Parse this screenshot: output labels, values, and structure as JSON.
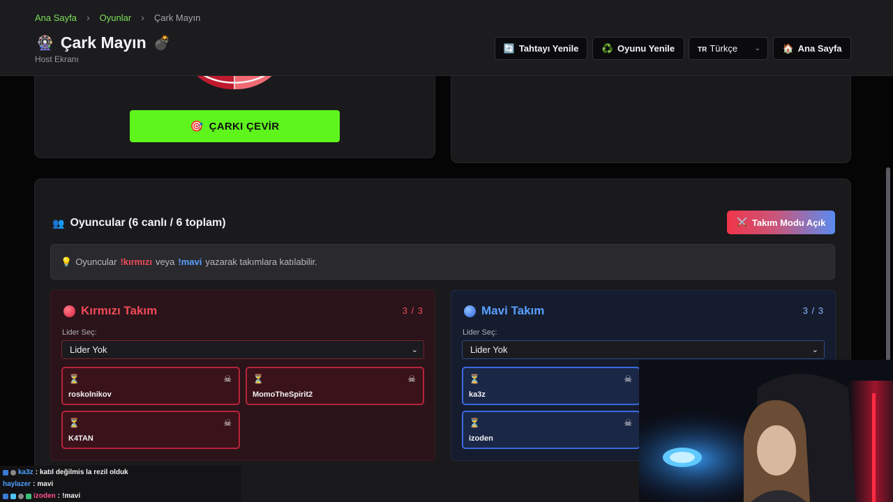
{
  "breadcrumb": {
    "home": "Ana Sayfa",
    "games": "Oyunlar",
    "current": "Çark Mayın"
  },
  "header": {
    "title": "Çark Mayın",
    "subtitle": "Host Ekranı",
    "icons": {
      "title_left": "ferris-wheel-icon",
      "title_right": "bomb-icon"
    },
    "buttons": {
      "refresh_board": "Tahtayı Yenile",
      "refresh_game": "Oyunu Yenile",
      "language_flag": "TR",
      "language": "Türkçe",
      "home": "Ana Sayfa"
    }
  },
  "wheel": {
    "spin_label": "ÇARKI ÇEVİR",
    "spin_icon": "target-icon"
  },
  "players": {
    "title": "Oyuncular (6 canlı / 6 toplam)",
    "team_mode_label": "Takım Modu Açık",
    "info": {
      "prefix": "Oyuncular",
      "red_cmd": "!kırmızı",
      "middle": "veya",
      "blue_cmd": "!mavi",
      "suffix": "yazarak takımlara katılabilir."
    }
  },
  "teams": {
    "red": {
      "name": "Kırmızı Takım",
      "count": "3 / 3",
      "leader_label": "Lider Seç:",
      "leader_value": "Lider Yok",
      "players": [
        "roskolnikov",
        "MomoTheSpirit2",
        "K4TAN"
      ]
    },
    "blue": {
      "name": "Mavi Takım",
      "count": "3 / 3",
      "leader_label": "Lider Seç:",
      "leader_value": "Lider Yok",
      "players": [
        "ka3z",
        "izoden"
      ]
    }
  },
  "chat": [
    {
      "user": "ka3z",
      "message": "katıl değilmis la rezil olduk"
    },
    {
      "user": "haylazer",
      "message": "mavi"
    },
    {
      "user": "izoden",
      "message": "!mavi"
    }
  ],
  "colors": {
    "accent_green": "#5ef51d",
    "red_team": "#f04a58",
    "blue_team": "#5aa0ff",
    "breadcrumb_link": "#7ee05a"
  }
}
